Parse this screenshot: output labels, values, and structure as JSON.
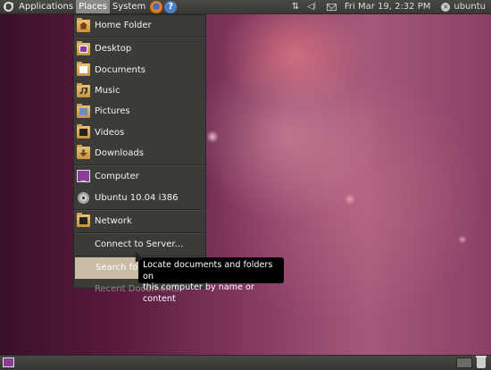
{
  "top_panel": {
    "menus": [
      "Applications",
      "Places",
      "System"
    ],
    "launchers": [
      "firefox-icon",
      "help-icon"
    ],
    "clock": "Fri Mar 19,  2:32 PM",
    "user": "ubuntu",
    "tray_icons": [
      "network-icon",
      "volume-icon",
      "mail-icon",
      "power-icon"
    ]
  },
  "places_menu": {
    "items": [
      {
        "label": "Home Folder",
        "icon": "home-folder-icon"
      },
      {
        "label": "Desktop",
        "icon": "desktop-folder-icon"
      },
      {
        "label": "Documents",
        "icon": "documents-folder-icon"
      },
      {
        "label": "Music",
        "icon": "music-folder-icon"
      },
      {
        "label": "Pictures",
        "icon": "pictures-folder-icon"
      },
      {
        "label": "Videos",
        "icon": "videos-folder-icon"
      },
      {
        "label": "Downloads",
        "icon": "downloads-folder-icon"
      },
      {
        "label": "Computer",
        "icon": "computer-icon"
      },
      {
        "label": "Ubuntu 10.04 i386",
        "icon": "cd-disc-icon"
      },
      {
        "label": "Network",
        "icon": "network-folder-icon"
      },
      {
        "label": "Connect to Server..."
      },
      {
        "label": "Search for Files..."
      },
      {
        "label": "Recent Documents"
      }
    ]
  },
  "tooltip": {
    "line1": "Locate documents and folders on",
    "line2": "this computer by name or content"
  },
  "bottom_panel": {
    "items": [
      "show-desktop-icon",
      "workspace-switcher",
      "trash-icon"
    ]
  },
  "colors": {
    "panel": "#3c3b37",
    "menu_bg": "#3c3b37",
    "highlight": "#c8bca6",
    "wallpaper": "#8a3e66"
  }
}
